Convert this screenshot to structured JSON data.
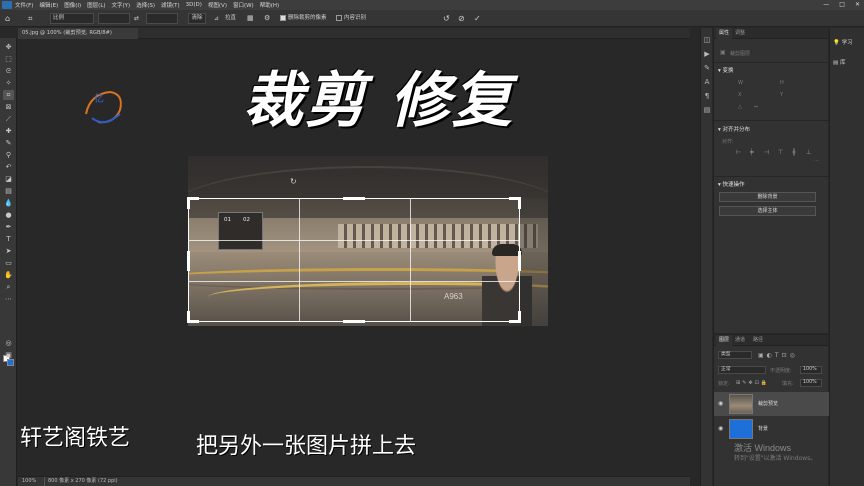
{
  "app": {
    "menu": [
      "文件(F)",
      "编辑(E)",
      "图像(I)",
      "图层(L)",
      "文字(Y)",
      "选择(S)",
      "滤镜(T)",
      "3D(D)",
      "视图(V)",
      "窗口(W)",
      "帮助(H)"
    ],
    "window_controls": [
      "—",
      "□",
      "✕"
    ]
  },
  "options_bar": {
    "ratio_select": "比例",
    "clear_button": "清除",
    "straighten_label": "拉直",
    "delete_cropped_label": "删除裁剪的像素",
    "content_aware_label": "内容识别",
    "delete_cropped_checked": true,
    "content_aware_checked": false
  },
  "document": {
    "tab_title": "05.jpg @ 100% (裁剪预览, RGB/8#)"
  },
  "image": {
    "screen_labels": [
      "01",
      "02"
    ],
    "room_label": "A963"
  },
  "overlay": {
    "title": "裁剪  修复",
    "logo_text": "亿",
    "subtitle_left": "轩艺阁铁艺",
    "subtitle_center": "把另外一张图片拼上去"
  },
  "status_bar": {
    "zoom": "100%",
    "dimensions": "800 像素 x 270 像素 (72 ppi)"
  },
  "properties_panel": {
    "tabs": [
      "属性",
      "调整"
    ],
    "layer_type": "裁剪图层",
    "transform_title": "变换",
    "transform_fields": [
      "W",
      "H",
      "X",
      "Y"
    ],
    "align_title": "对齐并分布",
    "align_label": "对齐:",
    "quick_actions_title": "快速操作",
    "remove_bg_button": "删除背景",
    "select_subject_button": "选择主体"
  },
  "learn_panel": {
    "items": [
      "学习",
      "库"
    ]
  },
  "layers_panel": {
    "tabs": [
      "图层",
      "通道",
      "路径"
    ],
    "search_placeholder": "类型",
    "blend_mode": "正常",
    "opacity_label": "不透明度:",
    "opacity_value": "100%",
    "lock_label": "锁定:",
    "fill_label": "填充:",
    "fill_value": "100%",
    "layers": [
      {
        "name": "裁剪预览",
        "selected": true
      },
      {
        "name": "背景",
        "selected": false
      }
    ]
  },
  "watermark": {
    "title": "激活 Windows",
    "subtitle": "转到\"设置\"以激活 Windows。"
  },
  "colors": {
    "foreground": "#ffffff",
    "background": "#1e6fd8",
    "accent_gold": "#d4b35a"
  }
}
